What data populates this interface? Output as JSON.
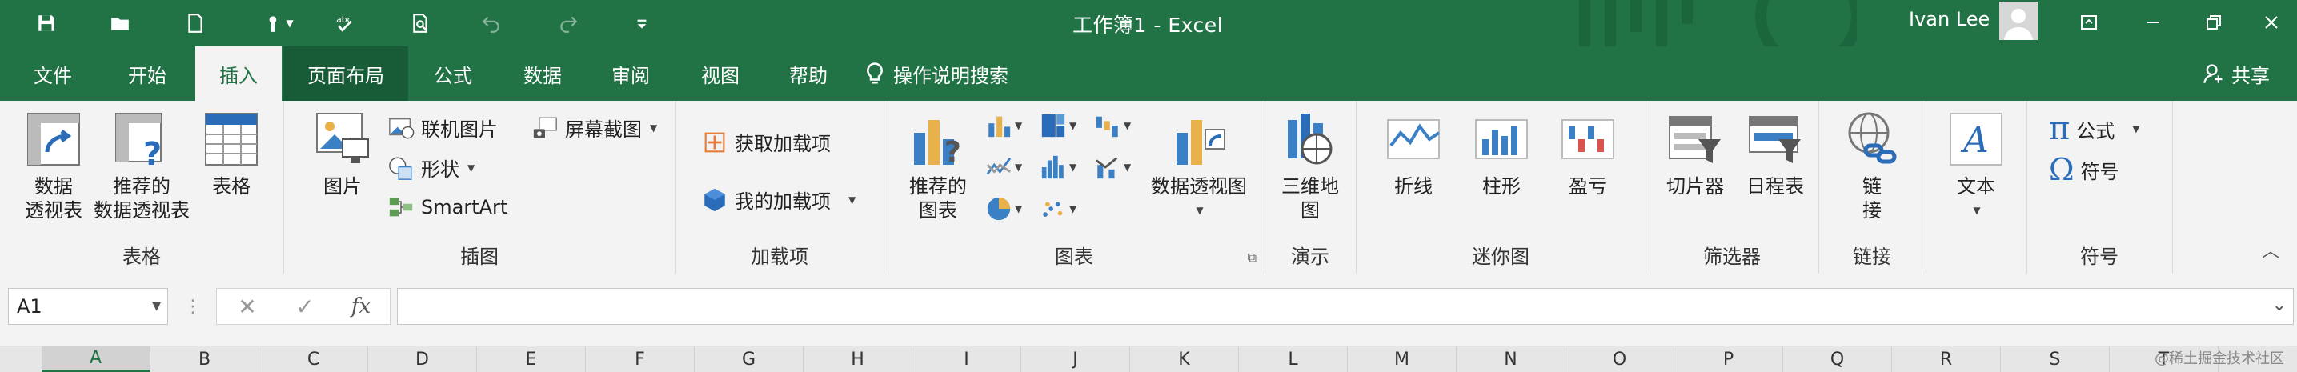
{
  "window": {
    "title": "工作簿1  -  Excel",
    "user": "Ivan Lee"
  },
  "quick_access": {
    "icons": [
      "save-icon",
      "open-folder-icon",
      "new-document-icon",
      "touch-mode-icon",
      "spelling-check-icon",
      "print-preview-icon",
      "undo-icon",
      "redo-icon",
      "customize-quick-access-icon"
    ]
  },
  "tabs": [
    {
      "id": "file",
      "label": "文件"
    },
    {
      "id": "home",
      "label": "开始"
    },
    {
      "id": "insert",
      "label": "插入"
    },
    {
      "id": "page-layout",
      "label": "页面布局"
    },
    {
      "id": "formulas",
      "label": "公式"
    },
    {
      "id": "data",
      "label": "数据"
    },
    {
      "id": "review",
      "label": "审阅"
    },
    {
      "id": "view",
      "label": "视图"
    },
    {
      "id": "help",
      "label": "帮助"
    }
  ],
  "tell_me": "操作说明搜索",
  "share": "共享",
  "groups": {
    "tables": {
      "label": "表格",
      "pivot": "数据\n透视表",
      "recommended_pivot": "推荐的\n数据透视表",
      "table": "表格"
    },
    "illustrations": {
      "label": "插图",
      "pictures": "图片",
      "online_pictures": "联机图片",
      "shapes": "形状",
      "smartart": "SmartArt",
      "screenshot": "屏幕截图"
    },
    "addins": {
      "label": "加载项",
      "get_addins": "获取加载项",
      "my_addins": "我的加载项"
    },
    "charts": {
      "label": "图表",
      "recommended_charts": "推荐的\n图表",
      "pivot_chart": "数据透视图"
    },
    "tours": {
      "label": "演示",
      "map3d": "三维地\n图"
    },
    "sparklines": {
      "label": "迷你图",
      "line": "折线",
      "column": "柱形",
      "winloss": "盈亏"
    },
    "filters": {
      "label": "筛选器",
      "slicer": "切片器",
      "timeline": "日程表"
    },
    "links": {
      "label": "链接",
      "link": "链\n接"
    },
    "text": {
      "label": "",
      "text": "文本"
    },
    "symbols": {
      "label": "符号",
      "equation": "公式",
      "symbol": "符号"
    }
  },
  "formula_bar": {
    "name_box": "A1",
    "fx": "fx",
    "formula": ""
  },
  "columns": [
    "A",
    "B",
    "C",
    "D",
    "E",
    "F",
    "G",
    "H",
    "I",
    "J",
    "K",
    "L",
    "M",
    "N",
    "O",
    "P",
    "Q",
    "R",
    "S",
    "T"
  ],
  "selected_column": "A",
  "watermark": "@稀土掘金技术社区",
  "colors": {
    "excel_green": "#217346",
    "dark_green": "#185c37",
    "ribbon_bg": "#f3f3f3"
  }
}
